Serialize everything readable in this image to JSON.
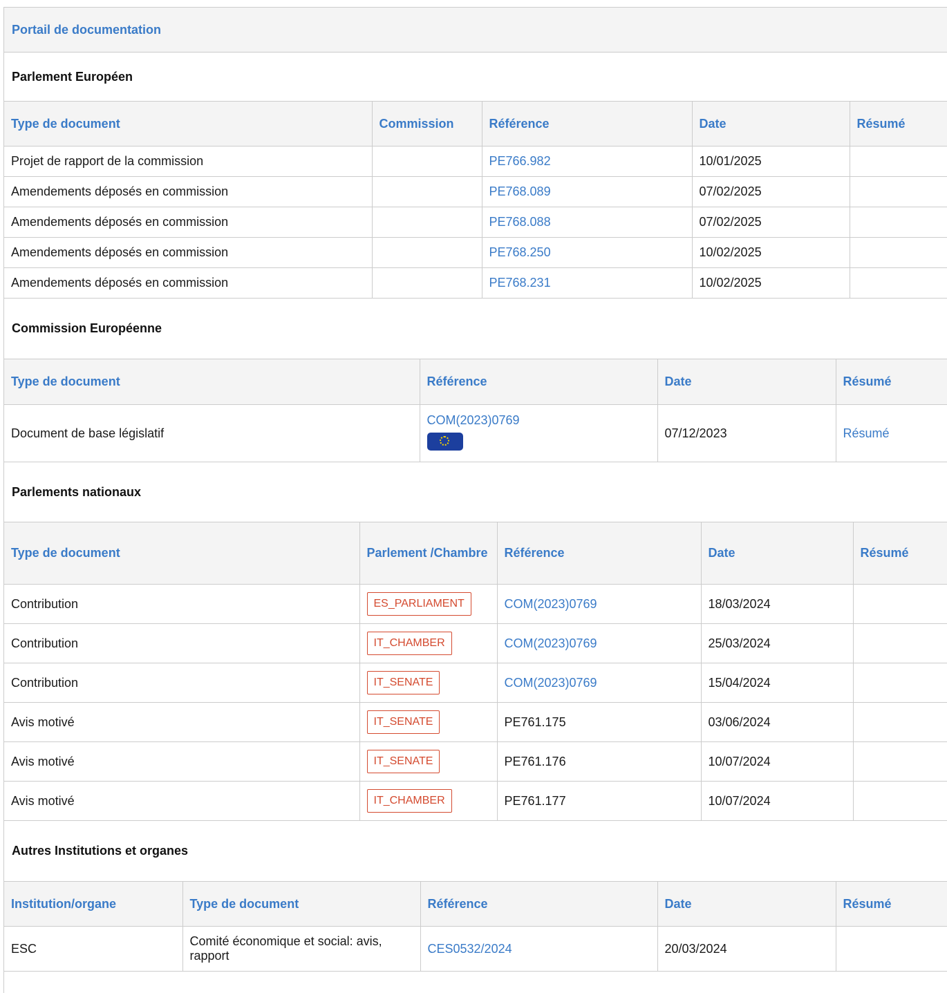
{
  "portal": {
    "title": "Portail de documentation"
  },
  "ep": {
    "title": "Parlement Européen",
    "headers": [
      "Type de document",
      "Commission",
      "Référence",
      "Date",
      "Résumé"
    ],
    "rows": [
      {
        "type": "Projet de rapport de la commission",
        "commission": "",
        "reference": "PE766.982",
        "date": "10/01/2025",
        "summary": ""
      },
      {
        "type": "Amendements déposés en commission",
        "commission": "",
        "reference": "PE768.089",
        "date": "07/02/2025",
        "summary": ""
      },
      {
        "type": "Amendements déposés en commission",
        "commission": "",
        "reference": "PE768.088",
        "date": "07/02/2025",
        "summary": ""
      },
      {
        "type": "Amendements déposés en commission",
        "commission": "",
        "reference": "PE768.250",
        "date": "10/02/2025",
        "summary": ""
      },
      {
        "type": "Amendements déposés en commission",
        "commission": "",
        "reference": "PE768.231",
        "date": "10/02/2025",
        "summary": ""
      }
    ]
  },
  "ec": {
    "title": "Commission Européenne",
    "headers": [
      "Type de document",
      "Référence",
      "Date",
      "Résumé"
    ],
    "rows": [
      {
        "type": "Document de base législatif",
        "reference": "COM(2023)0769",
        "reference_icon": "eu-flag-icon",
        "date": "07/12/2023",
        "summary": "Résumé"
      }
    ]
  },
  "np": {
    "title": "Parlements nationaux",
    "headers": [
      "Type de document",
      "Parlement /Chambre",
      "Référence",
      "Date",
      "Résumé"
    ],
    "rows": [
      {
        "type": "Contribution",
        "chamber": "ES_PARLIAMENT",
        "reference": "COM(2023)0769",
        "reference_link": true,
        "date": "18/03/2024",
        "summary": ""
      },
      {
        "type": "Contribution",
        "chamber": "IT_CHAMBER",
        "reference": "COM(2023)0769",
        "reference_link": true,
        "date": "25/03/2024",
        "summary": ""
      },
      {
        "type": "Contribution",
        "chamber": "IT_SENATE",
        "reference": "COM(2023)0769",
        "reference_link": true,
        "date": "15/04/2024",
        "summary": ""
      },
      {
        "type": "Avis motivé",
        "chamber": "IT_SENATE",
        "reference": "PE761.175",
        "reference_link": false,
        "date": "03/06/2024",
        "summary": ""
      },
      {
        "type": "Avis motivé",
        "chamber": "IT_SENATE",
        "reference": "PE761.176",
        "reference_link": false,
        "date": "10/07/2024",
        "summary": ""
      },
      {
        "type": "Avis motivé",
        "chamber": "IT_CHAMBER",
        "reference": "PE761.177",
        "reference_link": false,
        "date": "10/07/2024",
        "summary": ""
      }
    ]
  },
  "other": {
    "title": "Autres Institutions et organes",
    "headers": [
      "Institution/organe",
      "Type de document",
      "Référence",
      "Date",
      "Résumé"
    ],
    "rows": [
      {
        "institution": "ESC",
        "type": "Comité économique et social: avis, rapport",
        "reference": "CES0532/2024",
        "date": "20/03/2024",
        "summary": ""
      }
    ]
  },
  "colors": {
    "link": "#3a7bc8",
    "badge": "#d44a2f",
    "header_bg": "#f4f4f4",
    "border": "#cccccc"
  }
}
